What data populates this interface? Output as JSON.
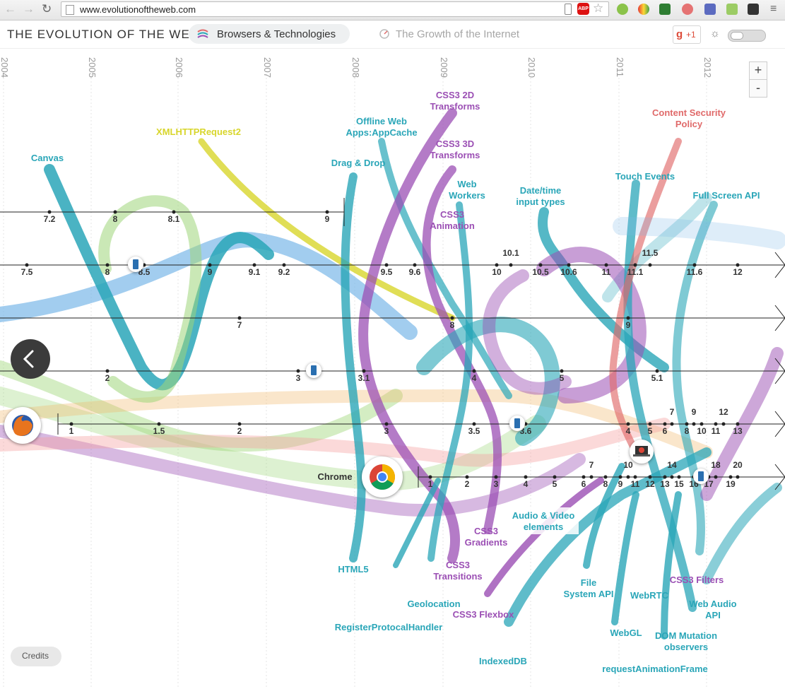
{
  "browser": {
    "url": "www.evolutionoftheweb.com",
    "back_icon": "back-arrow-icon",
    "forward_icon": "forward-arrow-icon",
    "reload_icon": "reload-icon"
  },
  "header": {
    "title": "THE EVOLUTION OF THE WEB",
    "tabs": [
      {
        "label": "Browsers & Technologies",
        "active": true
      },
      {
        "label": "The Growth of the Internet",
        "active": false
      }
    ],
    "gplus_g": "g",
    "gplus_label": "+1"
  },
  "years": [
    "2004",
    "2005",
    "2006",
    "2007",
    "2008",
    "2009",
    "2010",
    "2011",
    "2012"
  ],
  "zoom": {
    "in": "+",
    "out": "-"
  },
  "credits": "Credits",
  "browser_lines": [
    {
      "id": "opera",
      "versions": [
        "7.2",
        "8",
        "8.1",
        "9"
      ]
    },
    {
      "id": "safari-ish",
      "versions": [
        "7.5",
        "8",
        "8.5",
        "9",
        "9.1",
        "9.2",
        "9.5",
        "9.6",
        "10",
        "10.1",
        "10.5",
        "10.6",
        "11",
        "11.1",
        "11.5",
        "11.6",
        "12"
      ]
    },
    {
      "id": "ie",
      "versions": [
        "7",
        "8",
        "9"
      ]
    },
    {
      "id": "safari",
      "versions": [
        "2",
        "3",
        "3.1",
        "4",
        "5",
        "5.1"
      ]
    },
    {
      "id": "firefox",
      "versions": [
        "1",
        "1.5",
        "2",
        "3",
        "3.5",
        "3.6",
        "4",
        "5",
        "6",
        "7",
        "8",
        "9",
        "10",
        "11",
        "12",
        "13"
      ]
    },
    {
      "id": "chrome",
      "label": "Chrome",
      "versions": [
        "1",
        "2",
        "3",
        "4",
        "5",
        "6",
        "7",
        "8",
        "9",
        "10",
        "11",
        "12",
        "13",
        "14",
        "15",
        "16",
        "17",
        "18",
        "19",
        "20"
      ]
    }
  ],
  "technologies": [
    {
      "label": "Canvas",
      "color": "#2aa6b8"
    },
    {
      "label": "XMLHTTPRequest2",
      "color": "#d8d62c"
    },
    {
      "label": "Drag & Drop",
      "color": "#2aa6b8"
    },
    {
      "label": "Offline Web\nApps:AppCache",
      "color": "#2aa6b8"
    },
    {
      "label": "CSS3 2D\nTransforms",
      "color": "#9b4fb4"
    },
    {
      "label": "CSS3 3D\nTransforms",
      "color": "#9b4fb4"
    },
    {
      "label": "Web\nWorkers",
      "color": "#2aa6b8"
    },
    {
      "label": "CSS3\nAnimation",
      "color": "#9b4fb4"
    },
    {
      "label": "Date/time\ninput types",
      "color": "#2aa6b8"
    },
    {
      "label": "Content Security\nPolicy",
      "color": "#e06a6a"
    },
    {
      "label": "Touch Events",
      "color": "#2aa6b8"
    },
    {
      "label": "Full Screen API",
      "color": "#2aa6b8"
    },
    {
      "label": "HTML5",
      "color": "#2aa6b8"
    },
    {
      "label": "CSS3\nGradients",
      "color": "#9b4fb4"
    },
    {
      "label": "Audio & Video\nelements",
      "color": "#2aa6b8"
    },
    {
      "label": "CSS3\nTransitions",
      "color": "#9b4fb4"
    },
    {
      "label": "Geolocation",
      "color": "#2aa6b8"
    },
    {
      "label": "RegisterProtocalHandler",
      "color": "#2aa6b8"
    },
    {
      "label": "CSS3 Flexbox",
      "color": "#9b4fb4"
    },
    {
      "label": "File\nSystem API",
      "color": "#2aa6b8"
    },
    {
      "label": "WebRTC",
      "color": "#2aa6b8"
    },
    {
      "label": "CSS3 Filters",
      "color": "#9b4fb4"
    },
    {
      "label": "Web Audio\nAPI",
      "color": "#2aa6b8"
    },
    {
      "label": "WebGL",
      "color": "#2aa6b8"
    },
    {
      "label": "DOM Mutation\nobservers",
      "color": "#2aa6b8"
    },
    {
      "label": "IndexedDB",
      "color": "#2aa6b8"
    },
    {
      "label": "requestAnimationFrame",
      "color": "#2aa6b8"
    }
  ],
  "colors": {
    "teal": "#2aa6b8",
    "purple": "#9b4fb4",
    "yellow": "#d8d62c",
    "red": "#e06a6a",
    "light_green": "#9fd67a",
    "light_blue": "#7bb8e8",
    "orange": "#f2b76a",
    "pink": "#f4a0a0",
    "dark_text": "#333333"
  }
}
